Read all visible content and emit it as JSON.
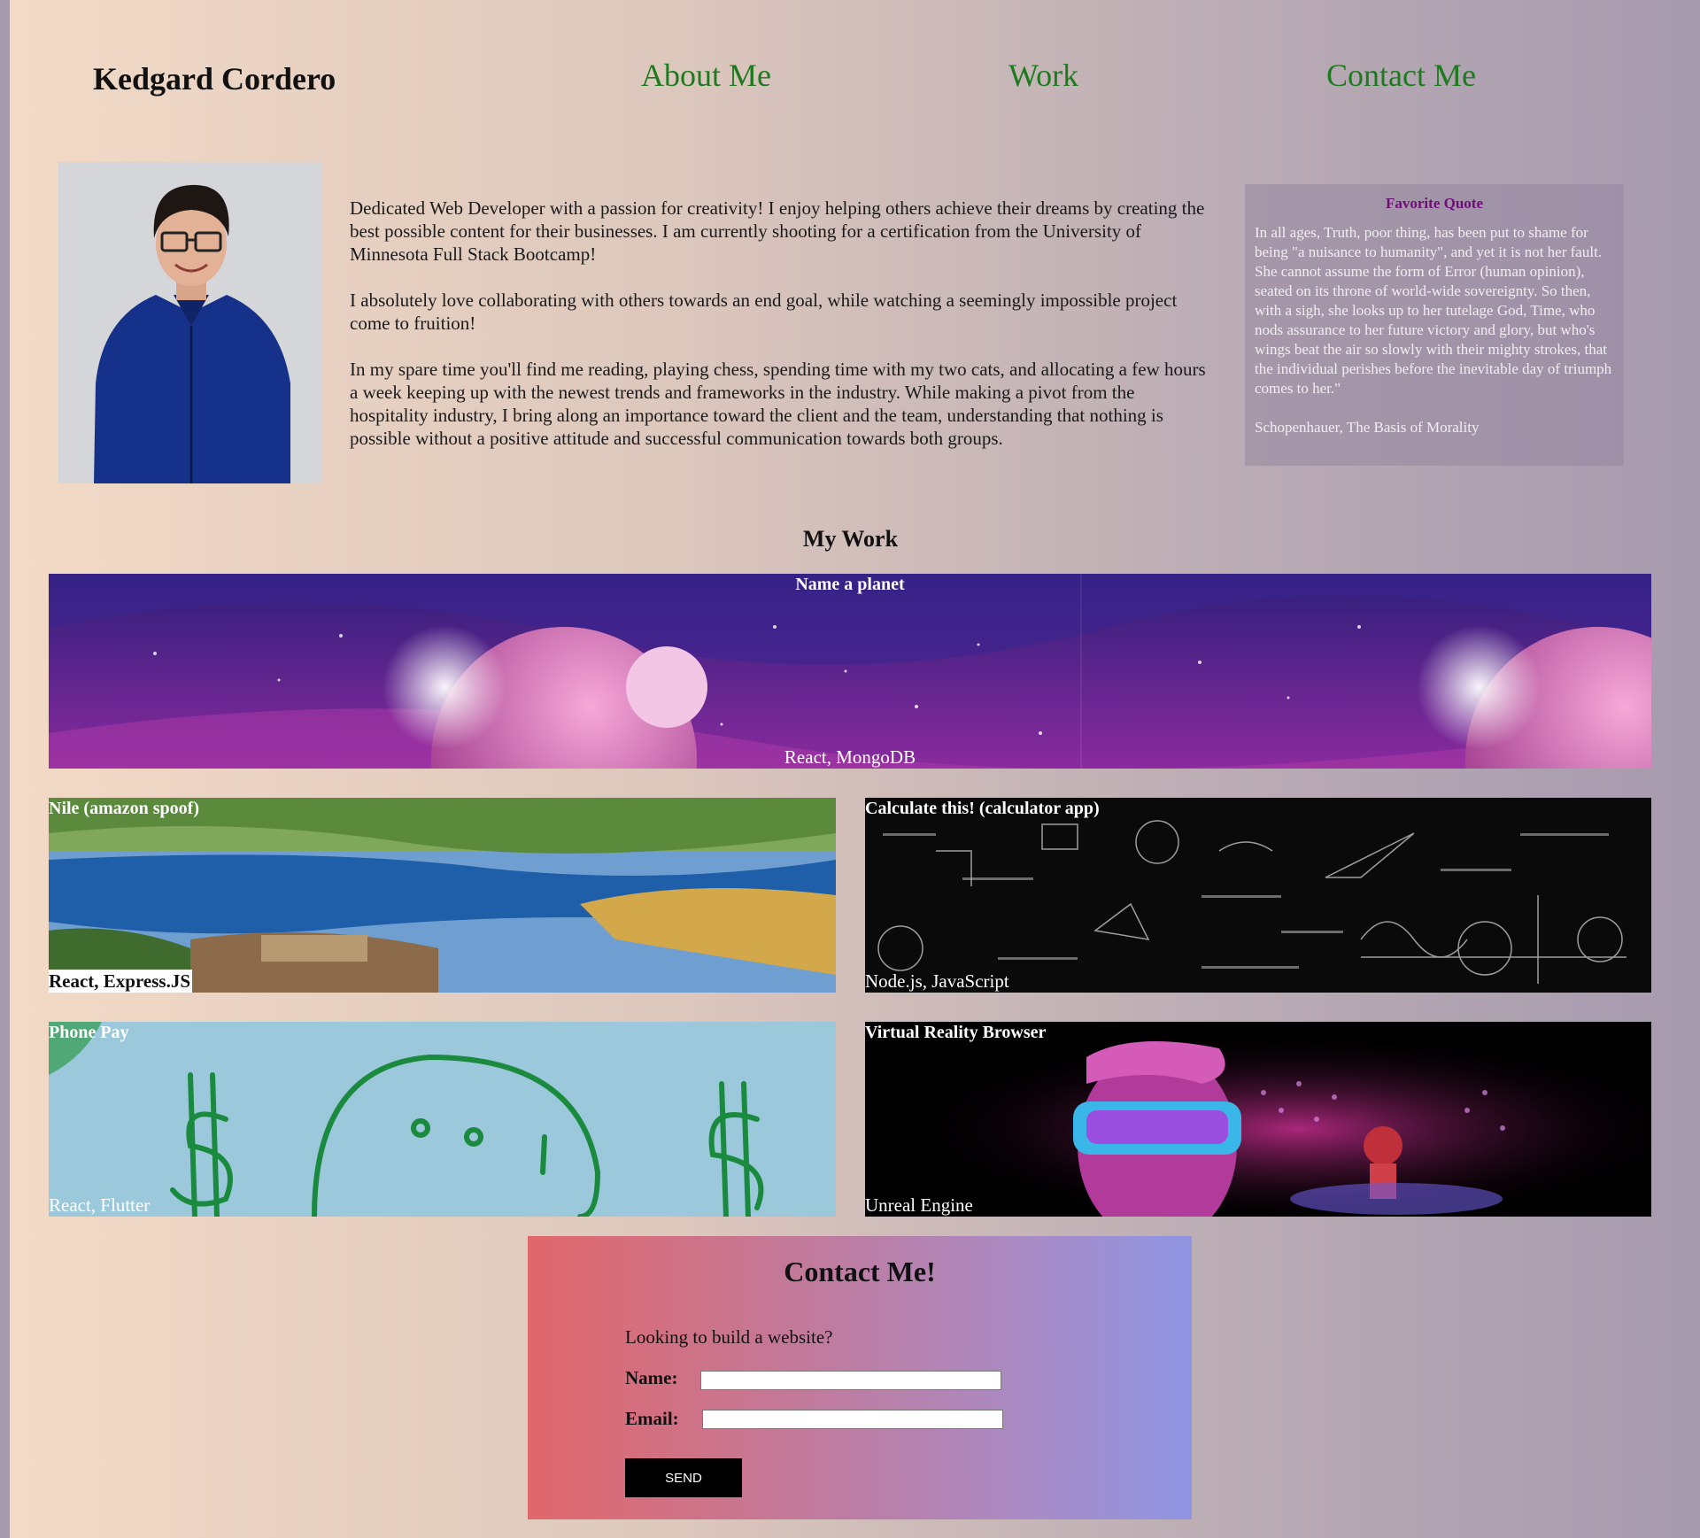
{
  "header": {
    "site_name": "Kedgard Cordero",
    "nav": [
      "About Me",
      "Work",
      "Contact Me"
    ]
  },
  "about": {
    "paragraphs": [
      "Dedicated Web Developer with a passion for creativity! I enjoy helping others achieve their dreams by creating the best possible content for their businesses. I am currently shooting for a certification from the University of Minnesota Full Stack Bootcamp!",
      "I absolutely love collaborating with others towards an end goal, while watching a seemingly impossible project come to fruition!",
      "In my spare time you'll find me reading, playing chess, spending time with my two cats, and allocating a few hours a week keeping up with the newest trends and frameworks in the industry. While making a pivot from the hospitality industry, I bring along an importance toward the client and the team, understanding that nothing is possible without a positive attitude and successful communication towards both groups."
    ],
    "quote": {
      "title": "Favorite Quote",
      "text": "In all ages, Truth, poor thing, has been put to shame for being \"a nuisance to humanity\", and yet it is not her fault. She cannot assume the form of Error (human opinion), seated on its throne of world-wide sovereignty. So then, with a sigh, she looks up to her tutelage God, Time, who nods assurance to her future victory and glory, but who's wings beat the air so slowly with their mighty strokes, that the individual perishes before the inevitable day of triumph comes to her.\"",
      "author": "Schopenhauer, The Basis of Morality"
    }
  },
  "work": {
    "title": "My Work",
    "projects": [
      {
        "title": "Name a planet",
        "tech": "React, MongoDB",
        "image": "purple-planet-space-art"
      },
      {
        "title": "Nile (amazon spoof)",
        "tech": "React, Express.JS",
        "image": "nile-river-landscape"
      },
      {
        "title": "Calculate this! (calculator app)",
        "tech": "Node.js, JavaScript",
        "image": "chalkboard-math-formulas"
      },
      {
        "title": "Phone Pay",
        "tech": "React, Flutter",
        "image": "green-dollar-sign-drawing"
      },
      {
        "title": "Virtual Reality Browser",
        "tech": "Unreal Engine",
        "image": "vr-headset-neon-illustration"
      }
    ]
  },
  "contact": {
    "title": "Contact Me!",
    "lead": "Looking to build a website?",
    "name_label": "Name:",
    "email_label": "Email:",
    "name_value": "",
    "email_value": "",
    "send_label": "SEND"
  },
  "colors": {
    "nav_link": "#1e7a1e",
    "quote_title": "#6e0f78",
    "contact_gradient_start": "#e1676b",
    "contact_gradient_end": "#8f95e3"
  }
}
